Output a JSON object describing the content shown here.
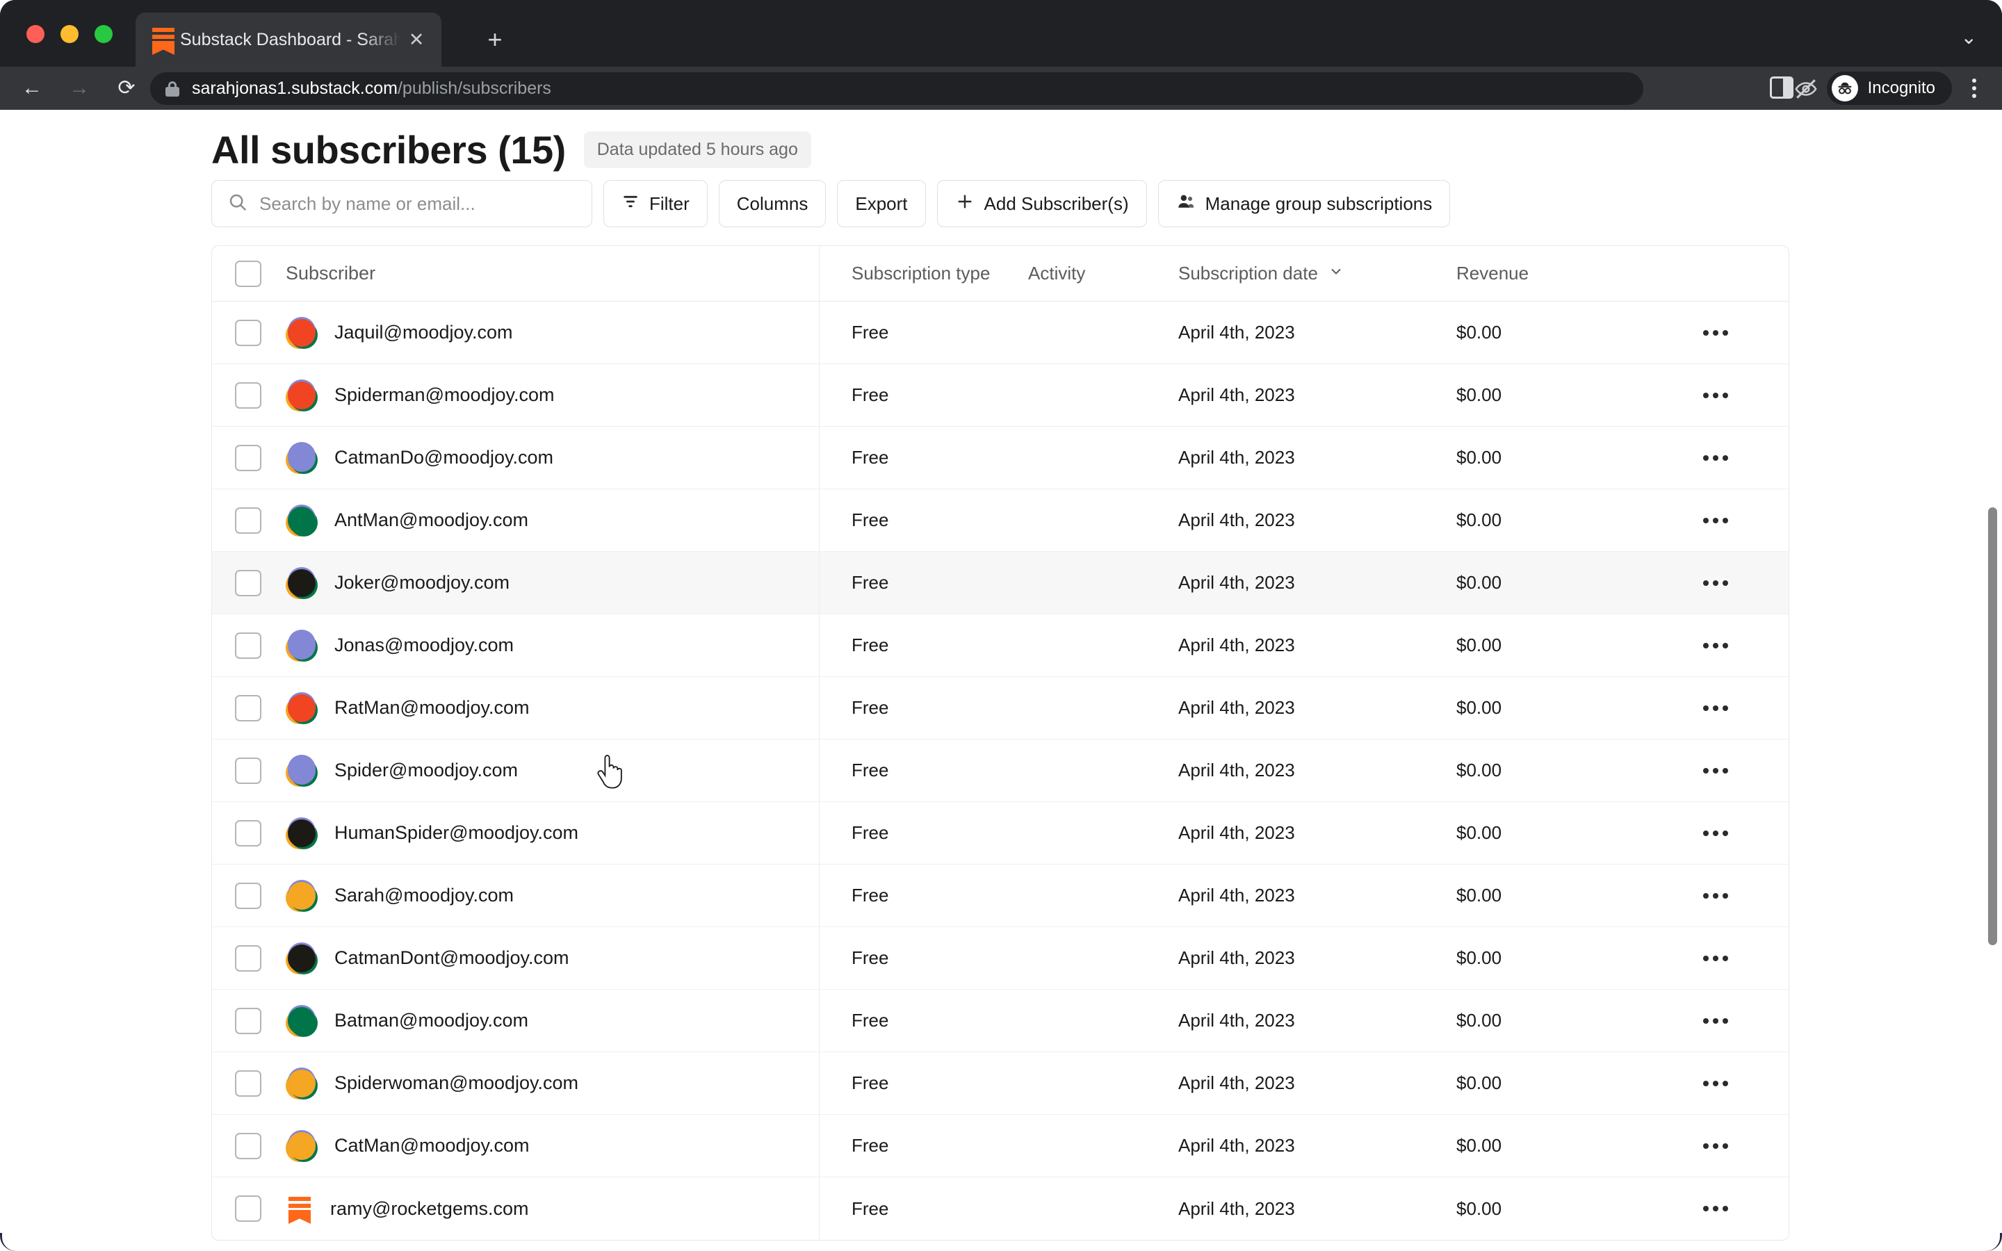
{
  "browser": {
    "tab": {
      "title": "Substack Dashboard - Sarah's",
      "favicon": "substack-icon",
      "close_label": "✕"
    },
    "new_tab_label": "+",
    "tabstrip_chevron": "⌄",
    "nav": {
      "back": "←",
      "forward": "→",
      "reload": "⟳"
    },
    "omnibox": {
      "url_host": "sarahjonas1.substack.com",
      "url_path": "/publish/subscribers",
      "lock_icon": "lock-icon"
    },
    "actions": {
      "tracking_icon": "eye-off-icon",
      "bookmark_icon": "star-icon",
      "side_panel_icon": "side-panel-icon",
      "profile_label": "Incognito",
      "menu_icon": "kebab-menu-icon"
    }
  },
  "header": {
    "title": "All subscribers (15)",
    "updated_badge": "Data updated 5 hours ago"
  },
  "toolbar": {
    "search_placeholder": "Search by name or email...",
    "search_value": "",
    "filter_label": "Filter",
    "columns_label": "Columns",
    "export_label": "Export",
    "add_subscriber_label": "Add Subscriber(s)",
    "add_subscriber_icon": "plus-icon",
    "manage_group_label": "Manage group subscriptions",
    "manage_group_icon": "people-icon",
    "filter_icon": "filter-icon",
    "search_icon": "search-icon"
  },
  "table": {
    "columns": {
      "subscriber": "Subscriber",
      "subscription_type": "Subscription type",
      "activity": "Activity",
      "subscription_date": "Subscription date",
      "sort_icon": "chevron-down-icon",
      "revenue": "Revenue"
    },
    "rows": [
      {
        "email": "Jaquil@moodjoy.com",
        "type": "Free",
        "activity": "",
        "date": "April 4th, 2023",
        "revenue": "$0.00",
        "avatar": "red",
        "hovered": false
      },
      {
        "email": "Spiderman@moodjoy.com",
        "type": "Free",
        "activity": "",
        "date": "April 4th, 2023",
        "revenue": "$0.00",
        "avatar": "red",
        "hovered": false
      },
      {
        "email": "CatmanDo@moodjoy.com",
        "type": "Free",
        "activity": "",
        "date": "April 4th, 2023",
        "revenue": "$0.00",
        "avatar": "purple",
        "hovered": false
      },
      {
        "email": "AntMan@moodjoy.com",
        "type": "Free",
        "activity": "",
        "date": "April 4th, 2023",
        "revenue": "$0.00",
        "avatar": "green",
        "hovered": false
      },
      {
        "email": "Joker@moodjoy.com",
        "type": "Free",
        "activity": "",
        "date": "April 4th, 2023",
        "revenue": "$0.00",
        "avatar": "black",
        "hovered": true
      },
      {
        "email": "Jonas@moodjoy.com",
        "type": "Free",
        "activity": "",
        "date": "April 4th, 2023",
        "revenue": "$0.00",
        "avatar": "purple",
        "hovered": false
      },
      {
        "email": "RatMan@moodjoy.com",
        "type": "Free",
        "activity": "",
        "date": "April 4th, 2023",
        "revenue": "$0.00",
        "avatar": "red",
        "hovered": false
      },
      {
        "email": "Spider@moodjoy.com",
        "type": "Free",
        "activity": "",
        "date": "April 4th, 2023",
        "revenue": "$0.00",
        "avatar": "purple",
        "hovered": false
      },
      {
        "email": "HumanSpider@moodjoy.com",
        "type": "Free",
        "activity": "",
        "date": "April 4th, 2023",
        "revenue": "$0.00",
        "avatar": "black",
        "hovered": false
      },
      {
        "email": "Sarah@moodjoy.com",
        "type": "Free",
        "activity": "",
        "date": "April 4th, 2023",
        "revenue": "$0.00",
        "avatar": "orange",
        "hovered": false
      },
      {
        "email": "CatmanDont@moodjoy.com",
        "type": "Free",
        "activity": "",
        "date": "April 4th, 2023",
        "revenue": "$0.00",
        "avatar": "black",
        "hovered": false
      },
      {
        "email": "Batman@moodjoy.com",
        "type": "Free",
        "activity": "",
        "date": "April 4th, 2023",
        "revenue": "$0.00",
        "avatar": "green",
        "hovered": false
      },
      {
        "email": "Spiderwoman@moodjoy.com",
        "type": "Free",
        "activity": "",
        "date": "April 4th, 2023",
        "revenue": "$0.00",
        "avatar": "orange",
        "hovered": false
      },
      {
        "email": "CatMan@moodjoy.com",
        "type": "Free",
        "activity": "",
        "date": "April 4th, 2023",
        "revenue": "$0.00",
        "avatar": "orange",
        "hovered": false
      },
      {
        "email": "ramy@rocketgems.com",
        "type": "Free",
        "activity": "",
        "date": "April 4th, 2023",
        "revenue": "$0.00",
        "avatar": "substack",
        "hovered": false
      }
    ],
    "row_menu_icon": "more-options-icon"
  },
  "colors": {
    "avatar_red": "#f04423",
    "avatar_purple": "#8287d6",
    "avatar_green": "#00754a",
    "avatar_black": "#1c1a15",
    "avatar_orange": "#f5a623",
    "substack_orange": "#ff6719",
    "chrome_bg": "#202124",
    "chrome_toolbar": "#35363a",
    "hover_row": "#f7f7f7",
    "badge_bg": "#f2f2f2"
  }
}
